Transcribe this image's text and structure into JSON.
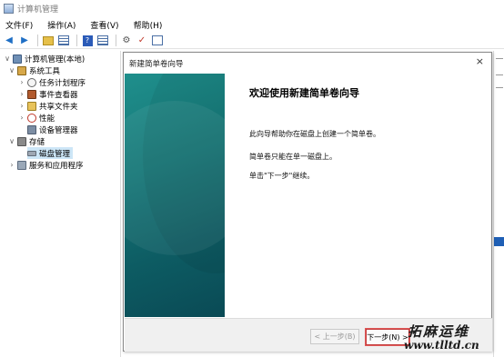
{
  "window": {
    "title": "计算机管理"
  },
  "menu": [
    "文件(F)",
    "操作(A)",
    "查看(V)",
    "帮助(H)"
  ],
  "toolbar": {
    "icons": [
      "back-arrow-icon",
      "forward-arrow-icon",
      "up-folder-icon",
      "show-hide-tree-icon",
      "help-icon",
      "list-view-icon",
      "properties-icon",
      "check-icon"
    ]
  },
  "tree": {
    "root": "计算机管理(本地)",
    "system_tools": "系统工具",
    "task_scheduler": "任务计划程序",
    "event_viewer": "事件查看器",
    "shared_folders": "共享文件夹",
    "performance": "性能",
    "device_manager": "设备管理器",
    "storage": "存储",
    "disk_management": "磁盘管理",
    "services_apps": "服务和应用程序"
  },
  "wizard": {
    "title": "新建简单卷向导",
    "heading": "欢迎使用新建简单卷向导",
    "line1": "此向导帮助你在磁盘上创建一个简单卷。",
    "line2": "简单卷只能在单一磁盘上。",
    "line3": "单击\"下一步\"继续。",
    "prev_button": "< 上一步(B)",
    "next_button": "下一步(N) >",
    "close_symbol": "×",
    "panel_color": "#167878"
  },
  "watermark": {
    "text": "拓麻运维",
    "url": "www.tlltd.cn"
  }
}
